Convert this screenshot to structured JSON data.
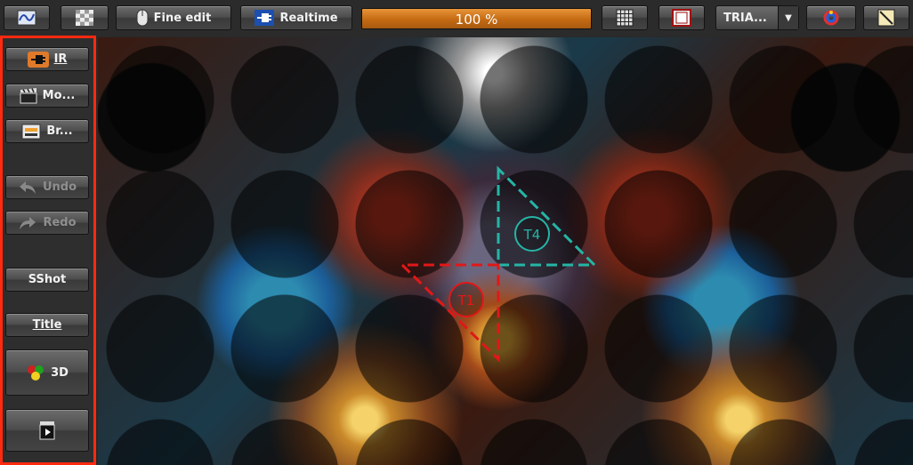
{
  "toolbar": {
    "fine_edit_label": "Fine edit",
    "realtime_label": "Realtime",
    "progress": {
      "text": "100 %",
      "fraction": 1.0
    },
    "dropdown_value": "TRIA..."
  },
  "sidebar": {
    "ir_label": "IR",
    "mo_label": "Mo...",
    "br_label": "Br...",
    "undo_label": "Undo",
    "redo_label": "Redo",
    "sshot_label": "SShot",
    "title_label": "Title",
    "three_d_label": "3D"
  },
  "canvas": {
    "triangles": [
      {
        "label": "T4",
        "color": "#25b5a6"
      },
      {
        "label": "T1",
        "color": "#e01818"
      }
    ]
  },
  "colors": {
    "progress_fill": "#c46a12",
    "highlight_border": "#ff2a10"
  },
  "icons": {
    "button1": "curve-icon",
    "button2": "checker-icon",
    "fine_edit": "mouse-icon",
    "realtime": "plug-icon",
    "grid": "grid-icon",
    "frame": "frame-icon",
    "palette": "palette-icon",
    "gradient": "gradient-icon"
  }
}
